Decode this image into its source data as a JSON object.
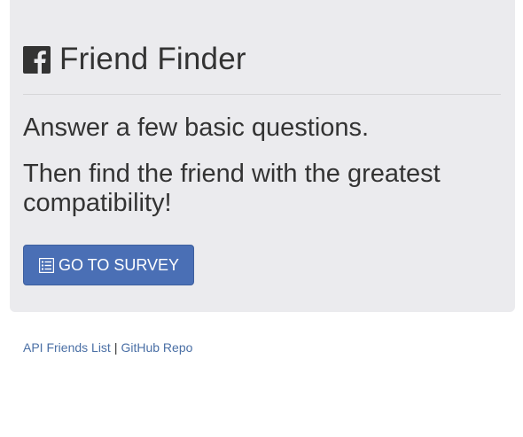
{
  "header": {
    "icon": "facebook-square-icon",
    "title": "Friend Finder"
  },
  "main": {
    "lead_line_1": "Answer a few basic questions.",
    "lead_line_2": "Then find the friend with the greatest compatibility!",
    "survey_button": {
      "icon": "list-alt-icon",
      "label": "GO TO SURVEY"
    }
  },
  "footer": {
    "api_link": "API Friends List",
    "separator": "|",
    "github_link": "GitHub Repo"
  },
  "colors": {
    "jumbotron_bg": "#ebebee",
    "button_bg": "#4a6fb5",
    "link": "#4a6fa5",
    "text": "#333333"
  }
}
